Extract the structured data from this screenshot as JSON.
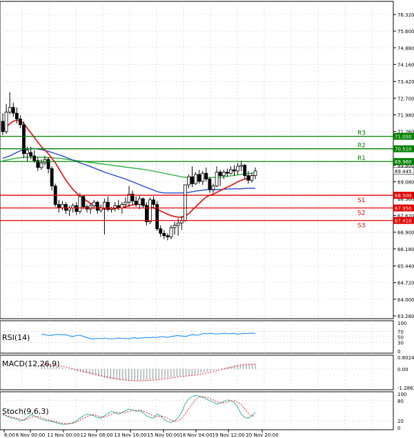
{
  "chart_data": {
    "type": "candlestick",
    "main": {
      "y_ticks": [
        "76.320",
        "75.600",
        "74.880",
        "74.160",
        "73.420",
        "72.700",
        "71.980",
        "71.260",
        "70.530",
        "69.800",
        "69.080",
        "68.360",
        "67.620",
        "66.900",
        "66.180",
        "65.440",
        "64.720",
        "64.000",
        "63.280"
      ],
      "ylim": [
        63.28,
        76.32
      ],
      "current_price": "69.445",
      "levels": [
        {
          "name": "R3",
          "value": 71.05,
          "label": "71.050",
          "color": "#008000"
        },
        {
          "name": "R2",
          "value": 70.51,
          "label": "70.510",
          "color": "#008000"
        },
        {
          "name": "R1",
          "value": 69.96,
          "label": "69.960",
          "color": "#008000"
        },
        {
          "name": "S1",
          "value": 68.5,
          "label": "68.500",
          "color": "#e00000"
        },
        {
          "name": "S2",
          "value": 67.95,
          "label": "67.950",
          "color": "#e00000"
        },
        {
          "name": "S3",
          "value": 67.41,
          "label": "67.410",
          "color": "#e00000"
        }
      ],
      "candles": [
        {
          "o": 71.7,
          "h": 72.05,
          "l": 71.1,
          "c": 71.25
        },
        {
          "o": 71.25,
          "h": 72.45,
          "l": 71.15,
          "c": 72.1
        },
        {
          "o": 72.1,
          "h": 72.95,
          "l": 72.0,
          "c": 72.3
        },
        {
          "o": 72.3,
          "h": 72.5,
          "l": 71.9,
          "c": 72.05
        },
        {
          "o": 72.05,
          "h": 72.3,
          "l": 71.6,
          "c": 71.8
        },
        {
          "o": 71.8,
          "h": 71.95,
          "l": 71.4,
          "c": 71.55
        },
        {
          "o": 71.55,
          "h": 71.7,
          "l": 70.1,
          "c": 70.3
        },
        {
          "o": 70.3,
          "h": 70.6,
          "l": 69.95,
          "c": 70.45
        },
        {
          "o": 70.35,
          "h": 70.6,
          "l": 70.05,
          "c": 70.2
        },
        {
          "o": 70.2,
          "h": 70.45,
          "l": 69.9,
          "c": 70.0
        },
        {
          "o": 70.0,
          "h": 70.15,
          "l": 69.55,
          "c": 69.7
        },
        {
          "o": 69.7,
          "h": 70.05,
          "l": 69.6,
          "c": 69.9
        },
        {
          "o": 69.9,
          "h": 70.2,
          "l": 69.8,
          "c": 70.05
        },
        {
          "o": 70.05,
          "h": 70.15,
          "l": 69.45,
          "c": 69.65
        },
        {
          "o": 69.65,
          "h": 69.75,
          "l": 68.7,
          "c": 68.9
        },
        {
          "o": 68.9,
          "h": 69.0,
          "l": 68.0,
          "c": 68.1
        },
        {
          "o": 68.1,
          "h": 68.3,
          "l": 67.75,
          "c": 67.95
        },
        {
          "o": 67.95,
          "h": 68.25,
          "l": 67.85,
          "c": 68.1
        },
        {
          "o": 68.1,
          "h": 68.2,
          "l": 67.7,
          "c": 67.85
        },
        {
          "o": 67.85,
          "h": 68.05,
          "l": 67.6,
          "c": 67.95
        },
        {
          "o": 67.95,
          "h": 68.15,
          "l": 67.75,
          "c": 68.05
        },
        {
          "o": 68.05,
          "h": 68.2,
          "l": 67.65,
          "c": 67.8
        },
        {
          "o": 67.8,
          "h": 68.6,
          "l": 67.7,
          "c": 68.45
        },
        {
          "o": 68.45,
          "h": 68.5,
          "l": 67.9,
          "c": 68.0
        },
        {
          "o": 68.0,
          "h": 68.1,
          "l": 67.75,
          "c": 67.9
        },
        {
          "o": 67.9,
          "h": 68.15,
          "l": 67.7,
          "c": 68.05
        },
        {
          "o": 68.05,
          "h": 68.3,
          "l": 67.9,
          "c": 68.2
        },
        {
          "o": 68.2,
          "h": 68.25,
          "l": 67.7,
          "c": 67.85
        },
        {
          "o": 67.85,
          "h": 68.1,
          "l": 67.75,
          "c": 67.95
        },
        {
          "o": 67.95,
          "h": 68.35,
          "l": 66.8,
          "c": 68.2
        },
        {
          "o": 68.2,
          "h": 68.45,
          "l": 67.8,
          "c": 67.9
        },
        {
          "o": 67.9,
          "h": 68.0,
          "l": 67.75,
          "c": 67.95
        },
        {
          "o": 67.95,
          "h": 68.2,
          "l": 67.8,
          "c": 68.05
        },
        {
          "o": 68.05,
          "h": 68.3,
          "l": 67.85,
          "c": 67.95
        },
        {
          "o": 67.95,
          "h": 68.2,
          "l": 67.7,
          "c": 68.1
        },
        {
          "o": 68.1,
          "h": 68.4,
          "l": 67.95,
          "c": 68.2
        },
        {
          "o": 68.2,
          "h": 68.9,
          "l": 68.0,
          "c": 68.55
        },
        {
          "o": 68.55,
          "h": 68.7,
          "l": 68.1,
          "c": 68.25
        },
        {
          "o": 68.25,
          "h": 68.45,
          "l": 68.0,
          "c": 68.1
        },
        {
          "o": 68.1,
          "h": 68.5,
          "l": 67.9,
          "c": 68.35
        },
        {
          "o": 68.35,
          "h": 68.4,
          "l": 67.95,
          "c": 68.05
        },
        {
          "o": 68.05,
          "h": 68.2,
          "l": 67.2,
          "c": 67.35
        },
        {
          "o": 67.35,
          "h": 68.4,
          "l": 67.25,
          "c": 68.3
        },
        {
          "o": 68.3,
          "h": 68.45,
          "l": 67.95,
          "c": 68.1
        },
        {
          "o": 68.1,
          "h": 68.25,
          "l": 66.95,
          "c": 67.05
        },
        {
          "o": 67.05,
          "h": 67.2,
          "l": 66.7,
          "c": 66.85
        },
        {
          "o": 66.85,
          "h": 67.0,
          "l": 66.6,
          "c": 66.75
        },
        {
          "o": 66.75,
          "h": 66.85,
          "l": 66.55,
          "c": 66.7
        },
        {
          "o": 66.7,
          "h": 67.2,
          "l": 66.6,
          "c": 67.1
        },
        {
          "o": 67.1,
          "h": 67.35,
          "l": 66.8,
          "c": 67.2
        },
        {
          "o": 67.2,
          "h": 67.5,
          "l": 66.75,
          "c": 67.3
        },
        {
          "o": 67.3,
          "h": 67.6,
          "l": 67.0,
          "c": 67.4
        },
        {
          "o": 67.4,
          "h": 68.5,
          "l": 67.35,
          "c": 68.95
        },
        {
          "o": 68.95,
          "h": 69.4,
          "l": 68.8,
          "c": 69.3
        },
        {
          "o": 69.3,
          "h": 69.75,
          "l": 68.85,
          "c": 69.0
        },
        {
          "o": 69.0,
          "h": 69.5,
          "l": 68.95,
          "c": 69.4
        },
        {
          "o": 69.4,
          "h": 69.6,
          "l": 69.0,
          "c": 69.1
        },
        {
          "o": 69.1,
          "h": 69.55,
          "l": 68.95,
          "c": 69.45
        },
        {
          "o": 69.45,
          "h": 69.7,
          "l": 69.1,
          "c": 69.2
        },
        {
          "o": 69.2,
          "h": 69.3,
          "l": 68.6,
          "c": 68.75
        },
        {
          "o": 68.75,
          "h": 69.0,
          "l": 68.6,
          "c": 68.9
        },
        {
          "o": 68.9,
          "h": 69.75,
          "l": 68.85,
          "c": 69.5
        },
        {
          "o": 69.5,
          "h": 69.6,
          "l": 68.9,
          "c": 69.35
        },
        {
          "o": 69.35,
          "h": 69.6,
          "l": 69.2,
          "c": 69.5
        },
        {
          "o": 69.5,
          "h": 69.65,
          "l": 69.3,
          "c": 69.45
        },
        {
          "o": 69.45,
          "h": 69.75,
          "l": 69.4,
          "c": 69.6
        },
        {
          "o": 69.6,
          "h": 69.8,
          "l": 69.35,
          "c": 69.55
        },
        {
          "o": 69.55,
          "h": 69.9,
          "l": 69.4,
          "c": 69.75
        },
        {
          "o": 69.75,
          "h": 70.0,
          "l": 69.55,
          "c": 69.8
        },
        {
          "o": 69.8,
          "h": 69.85,
          "l": 69.2,
          "c": 69.35
        },
        {
          "o": 69.35,
          "h": 69.55,
          "l": 69.0,
          "c": 69.15
        },
        {
          "o": 69.15,
          "h": 69.45,
          "l": 69.05,
          "c": 69.35
        },
        {
          "o": 69.35,
          "h": 69.7,
          "l": 69.2,
          "c": 69.55
        }
      ],
      "ma_fast": [
        71.3,
        71.45,
        71.6,
        71.7,
        71.75,
        71.72,
        71.6,
        71.4,
        71.2,
        71.0,
        70.8,
        70.6,
        70.45,
        70.3,
        70.1,
        69.9,
        69.65,
        69.4,
        69.15,
        68.95,
        68.75,
        68.6,
        68.45,
        68.35,
        68.25,
        68.15,
        68.08,
        68.0,
        67.95,
        67.9,
        67.9,
        67.9,
        67.92,
        67.95,
        67.98,
        68.0,
        68.05,
        68.08,
        68.1,
        68.12,
        68.1,
        68.05,
        68.0,
        67.95,
        67.9,
        67.82,
        67.75,
        67.68,
        67.62,
        67.58,
        67.55,
        67.55,
        67.6,
        67.7,
        67.85,
        68.0,
        68.15,
        68.3,
        68.42,
        68.5,
        68.55,
        68.62,
        68.7,
        68.78,
        68.85,
        68.92,
        69.0,
        69.08,
        69.15,
        69.2,
        69.22,
        69.3,
        69.4
      ],
      "ma_mid": [
        70.1,
        70.15,
        70.2,
        70.28,
        70.35,
        70.42,
        70.47,
        70.5,
        70.52,
        70.52,
        70.5,
        70.47,
        70.44,
        70.4,
        70.35,
        70.3,
        70.25,
        70.2,
        70.14,
        70.08,
        70.02,
        69.96,
        69.9,
        69.85,
        69.8,
        69.74,
        69.68,
        69.62,
        69.56,
        69.5,
        69.45,
        69.4,
        69.35,
        69.3,
        69.25,
        69.2,
        69.14,
        69.08,
        69.02,
        68.96,
        68.9,
        68.84,
        68.78,
        68.72,
        68.66,
        68.62,
        68.6,
        68.6,
        68.6,
        68.6,
        68.6,
        68.6,
        68.6,
        68.62,
        68.65,
        68.68,
        68.7,
        68.72,
        68.74,
        68.74,
        68.74,
        68.74,
        68.75,
        68.76,
        68.77,
        68.78,
        68.78,
        68.78,
        68.78,
        68.79,
        68.8,
        68.8,
        68.8
      ],
      "ma_slow": [
        70.0,
        70.02,
        70.05,
        70.08,
        70.1,
        70.12,
        70.14,
        70.15,
        70.15,
        70.15,
        70.15,
        70.15,
        70.14,
        70.13,
        70.12,
        70.11,
        70.1,
        70.08,
        70.06,
        70.04,
        70.02,
        70.0,
        69.98,
        69.96,
        69.94,
        69.92,
        69.9,
        69.88,
        69.86,
        69.84,
        69.82,
        69.8,
        69.78,
        69.76,
        69.74,
        69.72,
        69.7,
        69.68,
        69.66,
        69.64,
        69.62,
        69.6,
        69.57,
        69.54,
        69.51,
        69.48,
        69.45,
        69.42,
        69.39,
        69.36,
        69.33,
        69.3,
        69.28,
        69.26,
        69.25,
        69.24,
        69.24,
        69.24,
        69.25,
        69.26,
        69.27,
        69.28,
        69.29,
        69.3,
        69.32,
        69.34,
        69.36,
        69.38,
        69.4,
        69.42,
        69.44,
        69.46,
        69.48
      ]
    },
    "rsi": {
      "label": "RSI(14)",
      "y_ticks": [
        "100",
        "70",
        "50",
        "30",
        "0"
      ],
      "values": [
        60,
        58,
        56,
        55,
        57,
        59,
        58,
        57,
        58,
        55,
        52,
        53,
        56,
        55,
        52,
        48,
        45,
        43,
        44,
        45,
        44,
        46,
        44,
        43,
        44,
        45,
        46,
        44,
        45,
        43,
        46,
        47,
        45,
        46,
        47,
        48,
        47,
        49,
        48,
        50,
        51,
        50,
        48,
        52,
        53,
        55,
        54,
        53,
        52,
        55,
        58,
        57,
        56,
        60,
        62,
        61,
        63,
        62,
        60,
        61,
        62,
        63,
        61,
        62,
        63,
        60,
        61,
        62,
        62,
        63,
        64,
        62
      ]
    },
    "macd": {
      "label": "MACD(12,26,9)",
      "y_ticks": [
        "0.8024",
        "0.00",
        "-1.2862"
      ],
      "hist": [
        0.25,
        0.3,
        0.3,
        0.28,
        0.25,
        0.2,
        0.15,
        0.1,
        0.05,
        0.0,
        -0.05,
        -0.1,
        -0.15,
        -0.2,
        -0.25,
        -0.3,
        -0.35,
        -0.4,
        -0.45,
        -0.5,
        -0.55,
        -0.6,
        -0.65,
        -0.7,
        -0.72,
        -0.75,
        -0.78,
        -0.8,
        -0.82,
        -0.83,
        -0.84,
        -0.84,
        -0.83,
        -0.82,
        -0.8,
        -0.78,
        -0.76,
        -0.74,
        -0.72,
        -0.7,
        -0.67,
        -0.64,
        -0.61,
        -0.58,
        -0.55,
        -0.52,
        -0.5,
        -0.48,
        -0.46,
        -0.44,
        -0.42,
        -0.4,
        -0.35,
        -0.3,
        -0.25,
        -0.2,
        -0.15,
        -0.1,
        -0.05,
        0.0,
        0.05,
        0.1,
        0.15,
        0.2,
        0.25,
        0.3,
        0.33,
        0.36,
        0.38,
        0.38,
        0.36,
        0.35
      ],
      "signal": [
        0.3,
        0.31,
        0.31,
        0.3,
        0.28,
        0.25,
        0.22,
        0.18,
        0.13,
        0.08,
        0.03,
        -0.02,
        -0.07,
        -0.12,
        -0.17,
        -0.22,
        -0.27,
        -0.32,
        -0.37,
        -0.42,
        -0.47,
        -0.52,
        -0.57,
        -0.61,
        -0.65,
        -0.68,
        -0.71,
        -0.74,
        -0.76,
        -0.78,
        -0.8,
        -0.81,
        -0.82,
        -0.82,
        -0.81,
        -0.8,
        -0.79,
        -0.77,
        -0.75,
        -0.73,
        -0.71,
        -0.68,
        -0.65,
        -0.62,
        -0.59,
        -0.56,
        -0.53,
        -0.51,
        -0.49,
        -0.47,
        -0.45,
        -0.43,
        -0.4,
        -0.36,
        -0.32,
        -0.28,
        -0.23,
        -0.18,
        -0.13,
        -0.08,
        -0.03,
        0.02,
        0.07,
        0.12,
        0.16,
        0.2,
        0.24,
        0.27,
        0.3,
        0.32,
        0.33,
        0.34
      ]
    },
    "stoch": {
      "label": "Stoch(9,6,3)",
      "y_ticks": [
        "100",
        "80",
        "20",
        "0"
      ],
      "k": [
        40,
        35,
        30,
        28,
        25,
        20,
        22,
        30,
        38,
        35,
        30,
        25,
        22,
        20,
        18,
        15,
        12,
        10,
        10,
        12,
        15,
        20,
        28,
        35,
        40,
        38,
        35,
        30,
        28,
        35,
        42,
        48,
        45,
        40,
        45,
        50,
        55,
        52,
        48,
        50,
        45,
        35,
        30,
        28,
        40,
        35,
        25,
        18,
        15,
        20,
        30,
        45,
        70,
        85,
        92,
        95,
        93,
        90,
        85,
        80,
        75,
        70,
        72,
        78,
        82,
        80,
        75,
        60,
        40,
        30,
        28,
        35,
        45
      ],
      "d": [
        38,
        36,
        33,
        30,
        28,
        25,
        23,
        25,
        30,
        33,
        33,
        30,
        26,
        23,
        20,
        18,
        15,
        13,
        12,
        12,
        13,
        16,
        21,
        27,
        33,
        37,
        38,
        35,
        32,
        32,
        35,
        40,
        44,
        45,
        44,
        45,
        48,
        51,
        52,
        51,
        49,
        45,
        40,
        35,
        33,
        34,
        33,
        28,
        22,
        19,
        20,
        27,
        40,
        55,
        70,
        83,
        90,
        92,
        90,
        87,
        82,
        77,
        74,
        74,
        76,
        79,
        80,
        76,
        68,
        55,
        42,
        35,
        34
      ]
    },
    "x_tick_labels": [
      "6:00",
      "8 Nov 00:00",
      "11 Nov 00:00",
      "12 Nov 08:00",
      "13 Nov 16:00",
      "15 Nov 00:00",
      "18 Nov 04:00",
      "19 Nov 12:00",
      "20 Nov 20:00"
    ]
  }
}
